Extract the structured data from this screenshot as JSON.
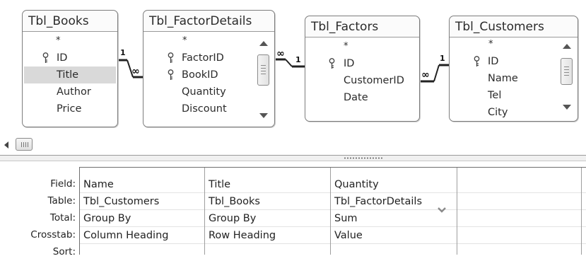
{
  "tables": [
    {
      "title": "Tbl_Books",
      "fields": [
        {
          "name": "*",
          "key": false
        },
        {
          "name": "ID",
          "key": true
        },
        {
          "name": "Title",
          "key": false,
          "selected": true
        },
        {
          "name": "Author",
          "key": false
        },
        {
          "name": "Price",
          "key": false
        }
      ]
    },
    {
      "title": "Tbl_FactorDetails",
      "fields": [
        {
          "name": "*",
          "key": false
        },
        {
          "name": "FactorID",
          "key": true
        },
        {
          "name": "BookID",
          "key": true
        },
        {
          "name": "Quantity",
          "key": false
        },
        {
          "name": "Discount",
          "key": false
        }
      ]
    },
    {
      "title": "Tbl_Factors",
      "fields": [
        {
          "name": "*",
          "key": false
        },
        {
          "name": "ID",
          "key": true
        },
        {
          "name": "CustomerID",
          "key": false
        },
        {
          "name": "Date",
          "key": false
        }
      ]
    },
    {
      "title": "Tbl_Customers",
      "fields": [
        {
          "name": "*",
          "key": false
        },
        {
          "name": "ID",
          "key": true
        },
        {
          "name": "Name",
          "key": false
        },
        {
          "name": "Tel",
          "key": false
        },
        {
          "name": "City",
          "key": false
        }
      ]
    }
  ],
  "relationships": [
    {
      "one_side": "1",
      "many_side": "∞"
    },
    {
      "one_side": "1",
      "many_side": "∞"
    },
    {
      "one_side": "1",
      "many_side": "∞"
    }
  ],
  "grid": {
    "row_labels": [
      "Field:",
      "Table:",
      "Total:",
      "Crosstab:",
      "Sort:"
    ],
    "columns": [
      {
        "field": "Name",
        "table": "Tbl_Customers",
        "total": "Group By",
        "crosstab": "Column Heading",
        "sort": ""
      },
      {
        "field": "Title",
        "table": "Tbl_Books",
        "total": "Group By",
        "crosstab": "Row Heading",
        "sort": ""
      },
      {
        "field": "Quantity",
        "table": "Tbl_FactorDetails",
        "total": "Sum",
        "crosstab": "Value",
        "sort": ""
      },
      {
        "field": "",
        "table": "",
        "total": "",
        "crosstab": "",
        "sort": ""
      }
    ]
  },
  "icons": {
    "key": "key-icon",
    "dropdown": "chevron-down-icon",
    "scroll_up": "scroll-up-arrow-icon",
    "scroll_down": "scroll-down-arrow-icon",
    "scroll_left": "scroll-left-arrow-icon"
  },
  "colors": {
    "selected_row": "#d9d9d9",
    "border": "#7d7d7d"
  }
}
